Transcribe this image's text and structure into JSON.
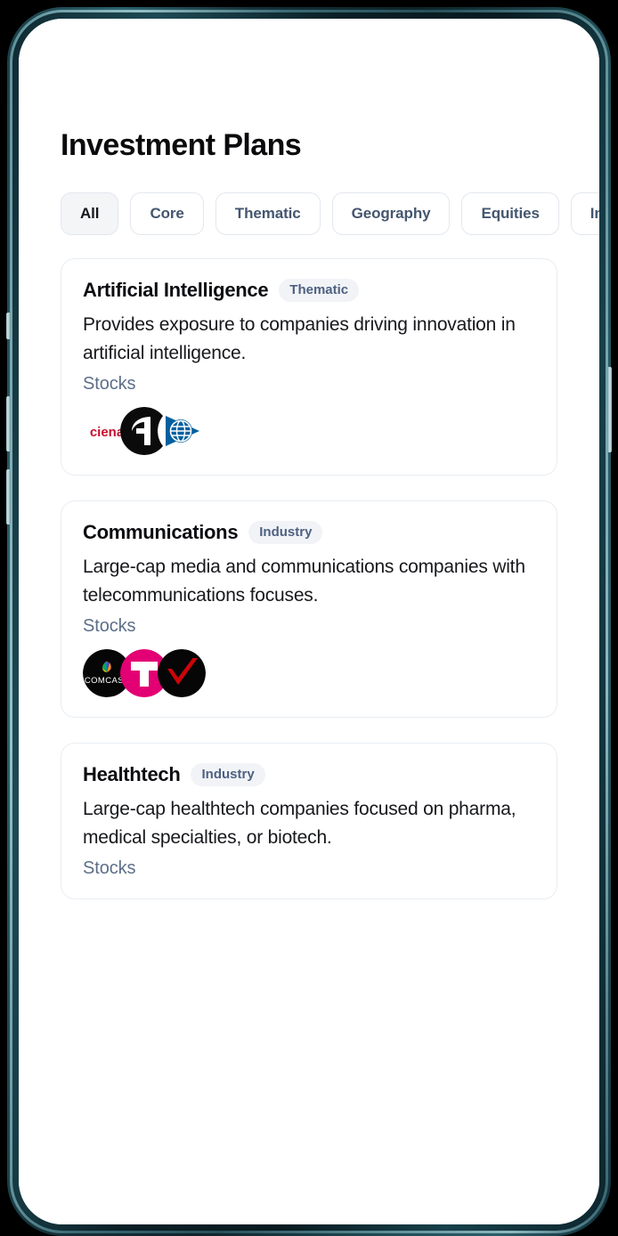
{
  "device": {
    "frame_color": "#16323b",
    "buttons": [
      "silent-switch",
      "volume-up",
      "volume-down",
      "power"
    ]
  },
  "header": {
    "title": "Investment Plans"
  },
  "filters": {
    "selected": "All",
    "chips": [
      {
        "label": "All",
        "selected": true
      },
      {
        "label": "Core",
        "selected": false
      },
      {
        "label": "Thematic",
        "selected": false
      },
      {
        "label": "Geography",
        "selected": false
      },
      {
        "label": "Equities",
        "selected": false
      },
      {
        "label": "Industry",
        "selected": false
      }
    ]
  },
  "colors": {
    "tag_bg": "#f1f3f7",
    "tag_text": "#4e6180",
    "asset_text": "#5d6f89",
    "card_border": "#e9edf3",
    "chip_border": "#e3e7ee",
    "chip_selected_bg": "#f4f5f7",
    "tmobile_magenta": "#e20074",
    "verizon_red": "#cd040b",
    "ciena_red": "#c8102e",
    "trimble_blue": "#005f9e"
  },
  "plans": [
    {
      "title": "Artificial Intelligence",
      "tag": "Thematic",
      "description": "Provides exposure to companies driving innovation in artificial intelligence.",
      "asset_class": "Stocks",
      "holdings": [
        {
          "name": "ciena",
          "icon": "ciena-logo"
        },
        {
          "name": "Adobe",
          "icon": "adobe-logo"
        },
        {
          "name": "Trimble",
          "icon": "trimble-logo"
        }
      ]
    },
    {
      "title": "Communications",
      "tag": "Industry",
      "description": "Large-cap media and communications companies with telecommunications focuses.",
      "asset_class": "Stocks",
      "holdings": [
        {
          "name": "Comcast",
          "icon": "comcast-logo"
        },
        {
          "name": "T-Mobile",
          "icon": "tmobile-logo"
        },
        {
          "name": "Verizon",
          "icon": "verizon-logo"
        }
      ]
    },
    {
      "title": "Healthtech",
      "tag": "Industry",
      "description": "Large-cap healthtech companies focused on pharma, medical specialties, or biotech.",
      "asset_class": "Stocks",
      "holdings": []
    }
  ]
}
